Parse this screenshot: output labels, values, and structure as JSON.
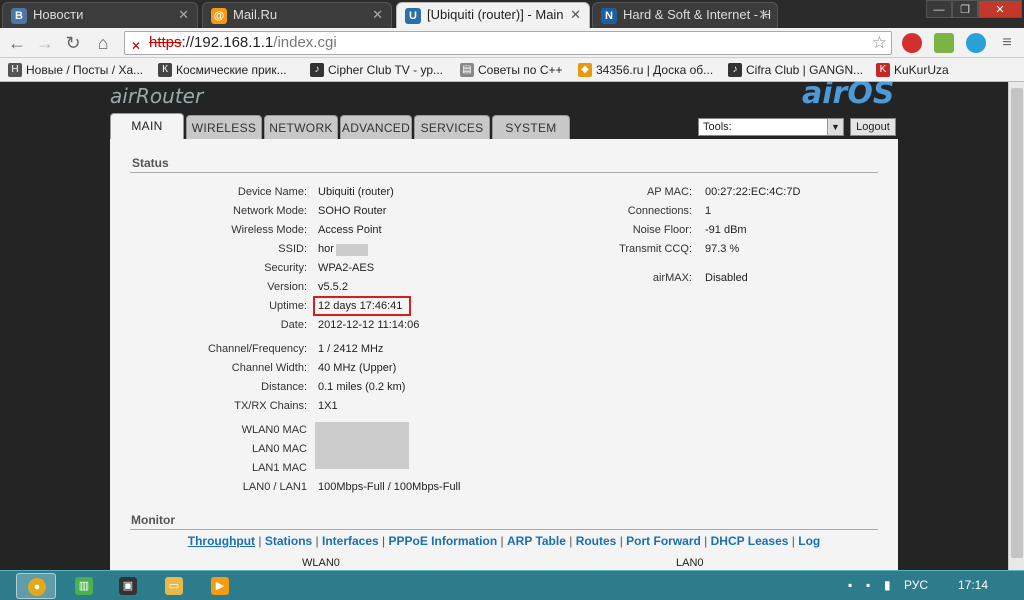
{
  "browser": {
    "tabs": [
      {
        "title": "Новости",
        "icon": "vk-icon"
      },
      {
        "title": "Mail.Ru",
        "icon": "mailru-icon"
      },
      {
        "title": "[Ubiquiti (router)] - Main",
        "icon": "ubiquiti-icon"
      },
      {
        "title": "Hard & Soft & Internet - H",
        "icon": "notion-icon"
      }
    ],
    "url": {
      "scheme": "https",
      "host": "://192.168.1.1",
      "path": "/index.cgi"
    },
    "bookmarks": [
      "Новые / Посты / Ха...",
      "Космические прик...",
      "Cipher Club TV - ур...",
      "Советы по C++",
      "34356.ru | Доска об...",
      "Cifra Club | GANGN...",
      "KuKurUza"
    ]
  },
  "airos": {
    "logo_left": "airRouter",
    "logo_right": "airOS",
    "tabs": [
      "MAIN",
      "WIRELESS",
      "NETWORK",
      "ADVANCED",
      "SERVICES",
      "SYSTEM"
    ],
    "active_tab": "MAIN",
    "tools": {
      "value": "Tools:"
    },
    "logout": "Logout",
    "status_title": "Status",
    "left": {
      "device_name": {
        "label": "Device Name:",
        "value": "Ubiquiti (router)"
      },
      "network_mode": {
        "label": "Network Mode:",
        "value": "SOHO Router"
      },
      "wireless_mode": {
        "label": "Wireless Mode:",
        "value": "Access Point"
      },
      "ssid": {
        "label": "SSID:",
        "value": "hor"
      },
      "security": {
        "label": "Security:",
        "value": "WPA2-AES"
      },
      "version": {
        "label": "Version:",
        "value": "v5.5.2"
      },
      "uptime": {
        "label": "Uptime:",
        "value": "12 days 17:46:41"
      },
      "date": {
        "label": "Date:",
        "value": "2012-12-12 11:14:06"
      },
      "channel": {
        "label": "Channel/Frequency:",
        "value": "1 / 2412 MHz"
      },
      "channel_width": {
        "label": "Channel Width:",
        "value": "40 MHz (Upper)"
      },
      "distance": {
        "label": "Distance:",
        "value": "0.1 miles (0.2 km)"
      },
      "chains": {
        "label": "TX/RX Chains:",
        "value": "1X1"
      },
      "wlan0_mac": {
        "label": "WLAN0 MAC"
      },
      "lan0_mac": {
        "label": "LAN0 MAC"
      },
      "lan1_mac": {
        "label": "LAN1 MAC"
      },
      "lan_speed": {
        "label": "LAN0 / LAN1",
        "value": "100Mbps-Full / 100Mbps-Full"
      }
    },
    "right": {
      "ap_mac": {
        "label": "AP MAC:",
        "value": "00:27:22:EC:4C:7D"
      },
      "connections": {
        "label": "Connections:",
        "value": "1"
      },
      "noise_floor": {
        "label": "Noise Floor:",
        "value": "-91 dBm"
      },
      "ccq": {
        "label": "Transmit CCQ:",
        "value": "97.3 %"
      },
      "airmax": {
        "label": "airMAX:",
        "value": "Disabled"
      }
    },
    "monitor_title": "Monitor",
    "monitor_links": [
      "Throughput",
      "Stations",
      "Interfaces",
      "PPPoE Information",
      "ARP Table",
      "Routes",
      "Port Forward",
      "DHCP Leases",
      "Log"
    ],
    "monitor_cols": [
      "WLAN0",
      "LAN0"
    ]
  },
  "taskbar": {
    "language": "РУС",
    "time": "17:14"
  }
}
